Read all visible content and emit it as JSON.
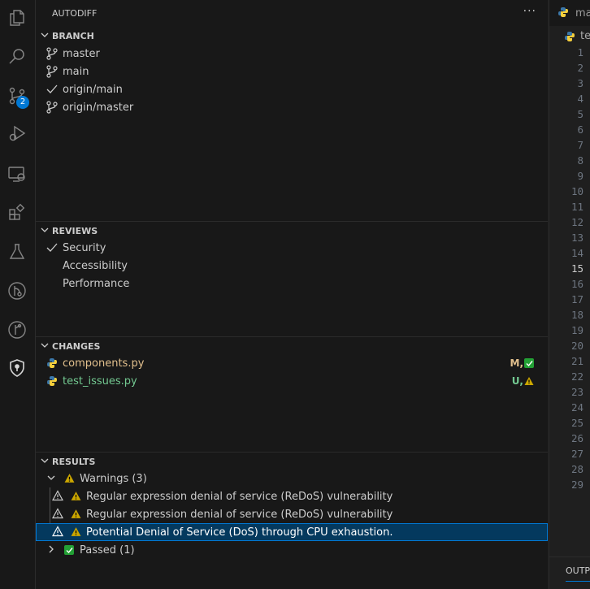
{
  "activity_bar": {
    "items": [
      "explorer-icon",
      "search-icon",
      "source-control-icon",
      "run-debug-icon",
      "remote-explorer-icon",
      "extensions-icon",
      "testing-icon",
      "git-graph-icon",
      "gitlens-icon",
      "autodiff-shield-icon"
    ],
    "source_control_badge": "2"
  },
  "sidebar": {
    "title": "AUTODIFF",
    "more": "···",
    "branch": {
      "header": "BRANCH",
      "items": [
        "master",
        "main",
        "origin/main",
        "origin/master"
      ]
    },
    "reviews": {
      "header": "REVIEWS",
      "items": [
        "Security",
        "Accessibility",
        "Performance"
      ],
      "checked": "Security"
    },
    "changes": {
      "header": "CHANGES",
      "files": [
        {
          "name": "components.py",
          "status": "M,",
          "status_icon": "green-check-icon"
        },
        {
          "name": "test_issues.py",
          "status": "U,",
          "status_icon": "warning-icon"
        }
      ]
    },
    "results": {
      "header": "RESULTS",
      "warnings_label": "Warnings (3)",
      "warnings": [
        "Regular expression denial of service (ReDoS) vulnerability",
        "Regular expression denial of service (ReDoS) vulnerability",
        "Potential Denial of Service (DoS) through CPU exhaustion."
      ],
      "passed_label": "Passed (1)"
    }
  },
  "editor": {
    "tab_label": "main.py",
    "breadcrumb": "test",
    "line_numbers": [
      "1",
      "2",
      "3",
      "4",
      "5",
      "6",
      "7",
      "8",
      "9",
      "10",
      "11",
      "12",
      "13",
      "14",
      "15",
      "16",
      "17",
      "18",
      "19",
      "20",
      "21",
      "22",
      "23",
      "24",
      "25",
      "26",
      "27",
      "28",
      "29"
    ],
    "active_line": "15",
    "panel_tab": "OUTPUT"
  },
  "colors": {
    "accent": "#0078d4",
    "modified": "#e2c08d",
    "untracked": "#73c991",
    "warning": "#cca700",
    "passed": "#23a035"
  }
}
